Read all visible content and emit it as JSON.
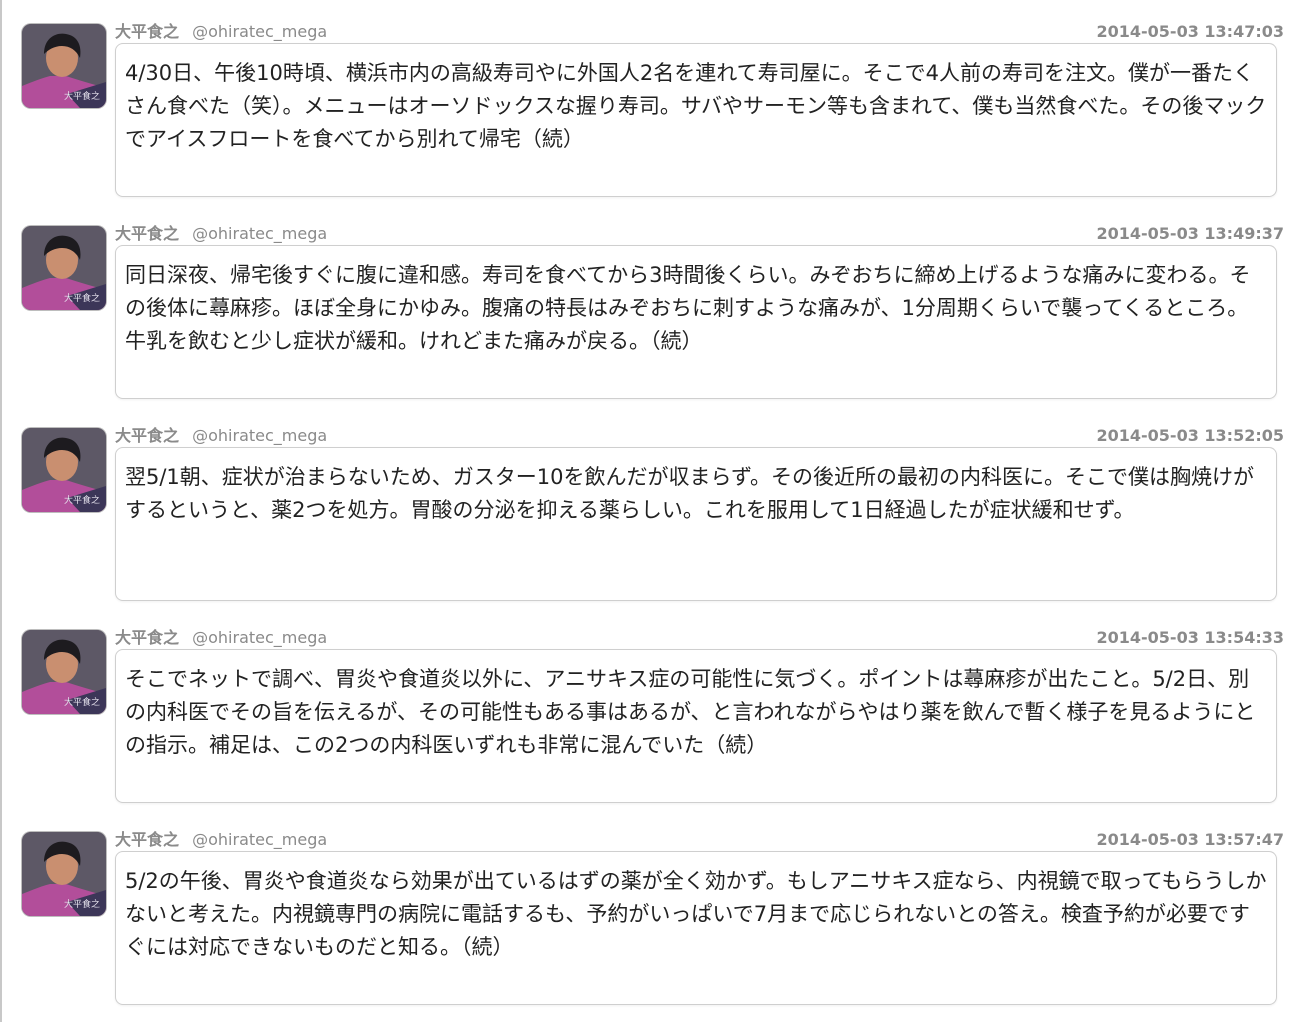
{
  "tweets": [
    {
      "author": "大平食之",
      "handle": "@ohiratec_mega",
      "timestamp": "2014-05-03 13:47:03",
      "avatar_caption": "大平食之",
      "text": "4/30日、午後10時頃、横浜市内の高級寿司やに外国人2名を連れて寿司屋に。そこで4人前の寿司を注文。僕が一番たくさん食べた（笑）。メニューはオーソドックスな握り寿司。サバやサーモン等も含まれて、僕も当然食べた。その後マックでアイスフロートを食べてから別れて帰宅（続）"
    },
    {
      "author": "大平食之",
      "handle": "@ohiratec_mega",
      "timestamp": "2014-05-03 13:49:37",
      "avatar_caption": "大平食之",
      "text": "同日深夜、帰宅後すぐに腹に違和感。寿司を食べてから3時間後くらい。みぞおちに締め上げるような痛みに変わる。その後体に蕁麻疹。ほぼ全身にかゆみ。腹痛の特長はみぞおちに刺すような痛みが、1分周期くらいで襲ってくるところ。牛乳を飲むと少し症状が緩和。けれどまた痛みが戻る。（続）"
    },
    {
      "author": "大平食之",
      "handle": "@ohiratec_mega",
      "timestamp": "2014-05-03 13:52:05",
      "avatar_caption": "大平食之",
      "text": "翌5/1朝、症状が治まらないため、ガスター10を飲んだが収まらず。その後近所の最初の内科医に。そこで僕は胸焼けがするというと、薬2つを処方。胃酸の分泌を抑える薬らしい。これを服用して1日経過したが症状緩和せず。"
    },
    {
      "author": "大平食之",
      "handle": "@ohiratec_mega",
      "timestamp": "2014-05-03 13:54:33",
      "avatar_caption": "大平食之",
      "text": "そこでネットで調べ、胃炎や食道炎以外に、アニサキス症の可能性に気づく。ポイントは蕁麻疹が出たこと。5/2日、別の内科医でその旨を伝えるが、その可能性もある事はあるが、と言われながらやはり薬を飲んで暫く様子を見るようにとの指示。補足は、この2つの内科医いずれも非常に混んでいた（続）"
    },
    {
      "author": "大平食之",
      "handle": "@ohiratec_mega",
      "timestamp": "2014-05-03 13:57:47",
      "avatar_caption": "大平食之",
      "text": "5/2の午後、胃炎や食道炎なら効果が出ているはずの薬が全く効かず。もしアニサキス症なら、内視鏡で取ってもらうしかないと考えた。内視鏡専門の病院に電話するも、予約がいっぱいで7月まで応じられないとの答え。検査予約が必要ですぐには対応できないものだと知る。（続）"
    }
  ]
}
